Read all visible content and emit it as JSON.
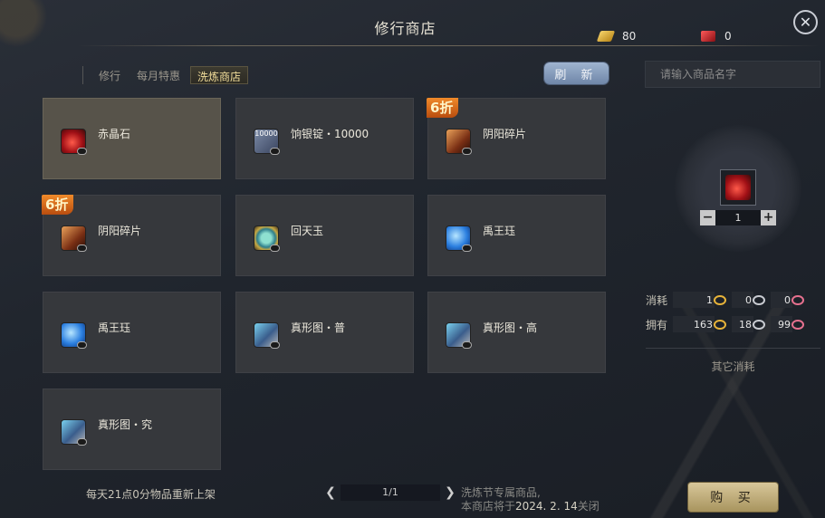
{
  "header": {
    "title": "修行商店",
    "close_icon": "close-icon"
  },
  "currencies": [
    {
      "icon": "gold-ingot-icon",
      "value": "80"
    },
    {
      "icon": "red-crystal-icon",
      "value": "0"
    }
  ],
  "tabs": [
    {
      "label": "修行",
      "active": false
    },
    {
      "label": "每月特惠",
      "active": false
    },
    {
      "label": "洗炼商店",
      "active": true
    }
  ],
  "refresh_label": "刷 新",
  "items": [
    {
      "name": "赤晶石",
      "icon": "red-crystal-icon",
      "discount": null,
      "selected": true
    },
    {
      "name": "饷银锭・10000",
      "icon": "silver-ingot-icon",
      "icon_text": "10000",
      "discount": null,
      "selected": false
    },
    {
      "name": "阴阳碎片",
      "icon": "yinyang-shard-icon",
      "discount": "6折",
      "selected": false
    },
    {
      "name": "阴阳碎片",
      "icon": "yinyang-shard-icon",
      "discount": "6折",
      "selected": false
    },
    {
      "name": "回天玉",
      "icon": "jade-icon",
      "discount": null,
      "selected": false
    },
    {
      "name": "禹王珏",
      "icon": "blue-orb-icon",
      "discount": null,
      "selected": false
    },
    {
      "name": "禹王珏",
      "icon": "blue-orb-icon",
      "discount": null,
      "selected": false
    },
    {
      "name": "真形图・普",
      "icon": "map-scroll-icon",
      "discount": null,
      "selected": false
    },
    {
      "name": "真形图・高",
      "icon": "map-scroll-icon",
      "discount": null,
      "selected": false
    },
    {
      "name": "真形图・究",
      "icon": "map-scroll-icon",
      "discount": null,
      "selected": false
    }
  ],
  "footer": {
    "restock_note": "每天21点0分物品重新上架",
    "page": "1/1",
    "event_line1": "洗炼节专属商品,",
    "event_line2_prefix": "本商店将于",
    "event_line2_date": "2024. 2. 14",
    "event_line2_suffix": "关闭"
  },
  "side": {
    "search_placeholder": "请输入商品名字",
    "quantity": "1",
    "cost_label": "消耗",
    "own_label": "拥有",
    "cost_values": [
      "1",
      "0",
      "0"
    ],
    "own_values": [
      "163",
      "18",
      "99"
    ],
    "coin_icons": [
      "gold-coin-icon",
      "silver-coin-icon",
      "pink-coin-icon"
    ],
    "other_cost": "其它消耗",
    "buy_label": "购 买"
  },
  "colors": {
    "accent_tab": "#f1dd9a",
    "refresh": "#8ba0c0",
    "discount": "#e0782a",
    "buy": "#c9b887"
  }
}
